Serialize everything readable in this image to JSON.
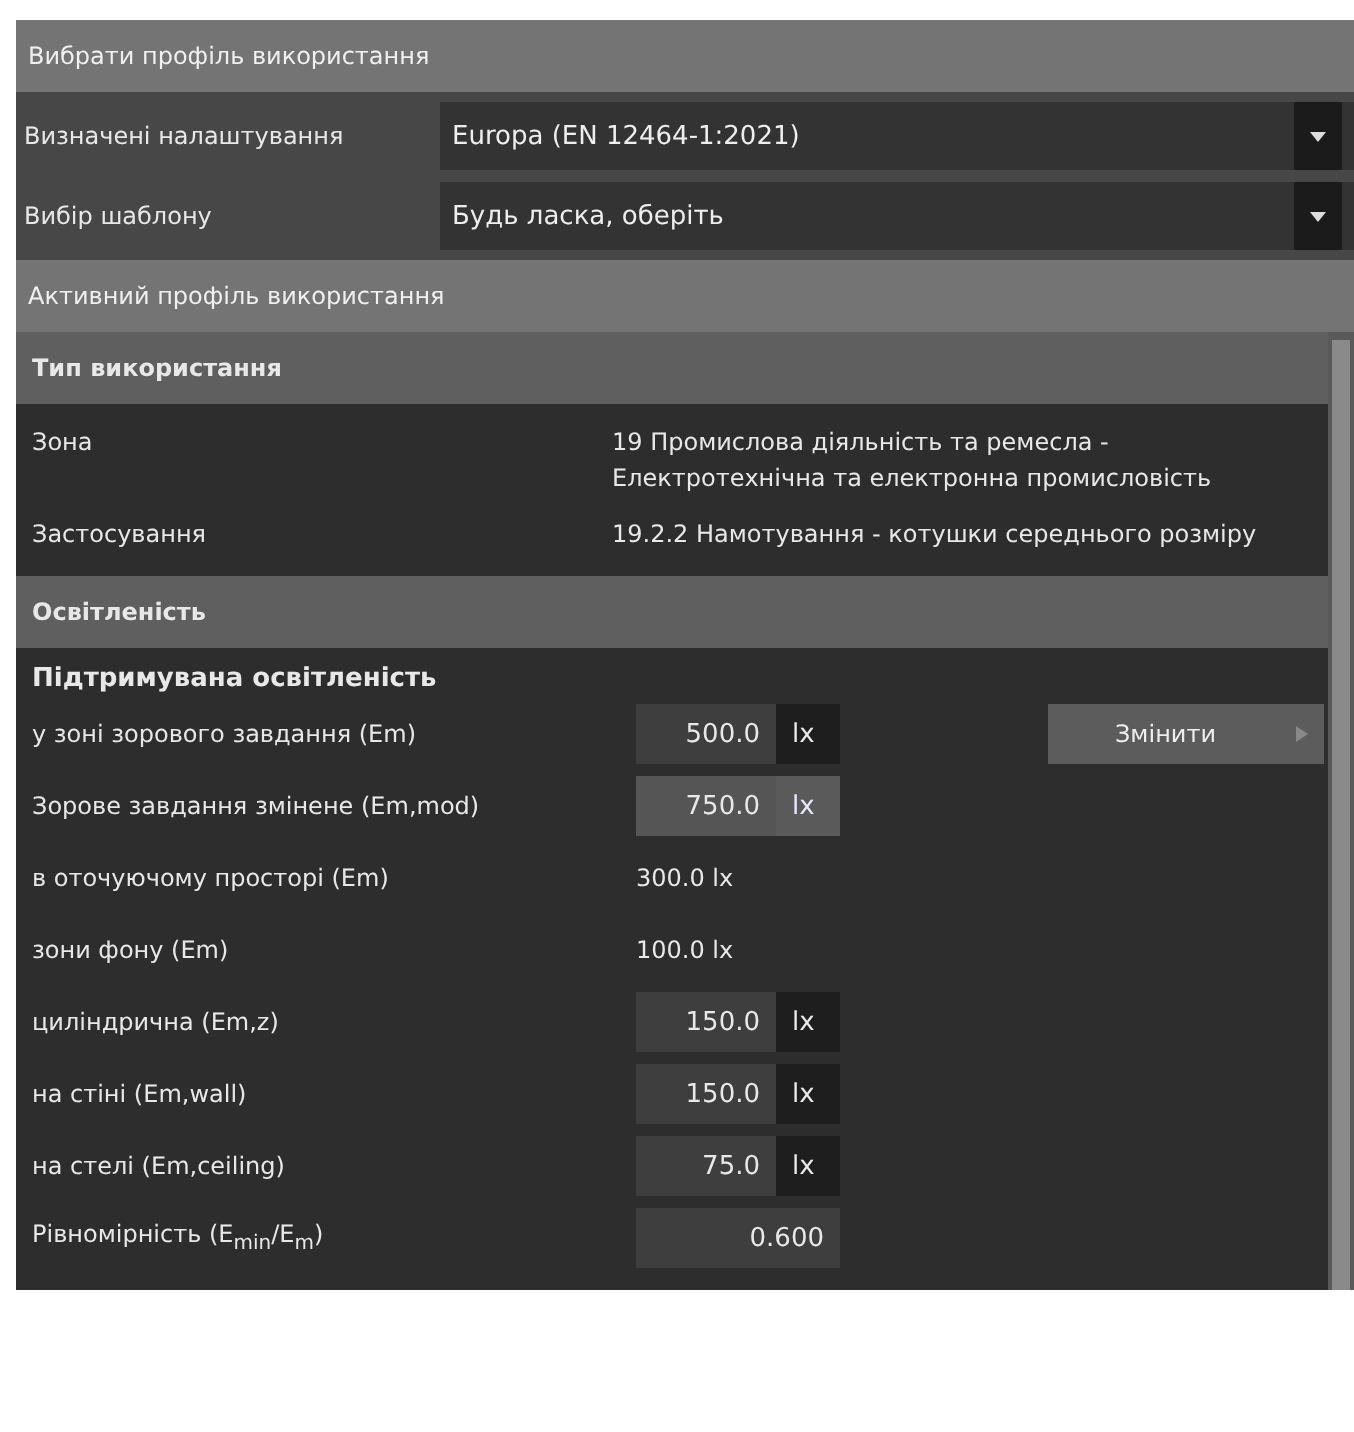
{
  "profile_select": {
    "title": "Вибрати профіль використання",
    "dropdowns": [
      {
        "label": "Визначені налаштування",
        "value": "Europa (EN 12464-1:2021)"
      },
      {
        "label": "Вибір шаблону",
        "value": "Будь ласка, оберіть"
      }
    ]
  },
  "active_profile": {
    "title": "Активний профіль використання",
    "usage_type": {
      "title": "Тип використання",
      "rows": [
        {
          "label": "Зона",
          "value": "19 Промислова діяльність та ремесла - Електротехнічна та електронна промисловість"
        },
        {
          "label": "Застосування",
          "value": "19.2.2 Намотування - котушки середнього розміру"
        }
      ]
    },
    "illuminance": {
      "title": "Освітленість",
      "subtitle": "Підтримувана освітленість",
      "change_button": "Змінити",
      "rows": [
        {
          "kind": "field",
          "label": "у зоні зорового завдання (Em)",
          "value": "500.0",
          "unit": "lx"
        },
        {
          "kind": "accent",
          "label": "Зорове завдання змінене (Em,mod)",
          "value": "750.0",
          "unit": "lx"
        },
        {
          "kind": "reading",
          "label": "в оточуючому просторі (Em)",
          "value": "300.0 lx"
        },
        {
          "kind": "reading",
          "label": "зони фону (Em)",
          "value": "100.0 lx"
        },
        {
          "kind": "field",
          "label": "циліндрична (Em,z)",
          "value": "150.0",
          "unit": "lx"
        },
        {
          "kind": "field",
          "label": "на стіні (Em,wall)",
          "value": "150.0",
          "unit": "lx"
        },
        {
          "kind": "field",
          "label": "на стелі (Em,ceiling)",
          "value": "75.0",
          "unit": "lx"
        },
        {
          "kind": "ratio",
          "label": "Рівномірність (E$_{min}$/E$_{m}$)",
          "value": "0.600"
        }
      ]
    }
  }
}
